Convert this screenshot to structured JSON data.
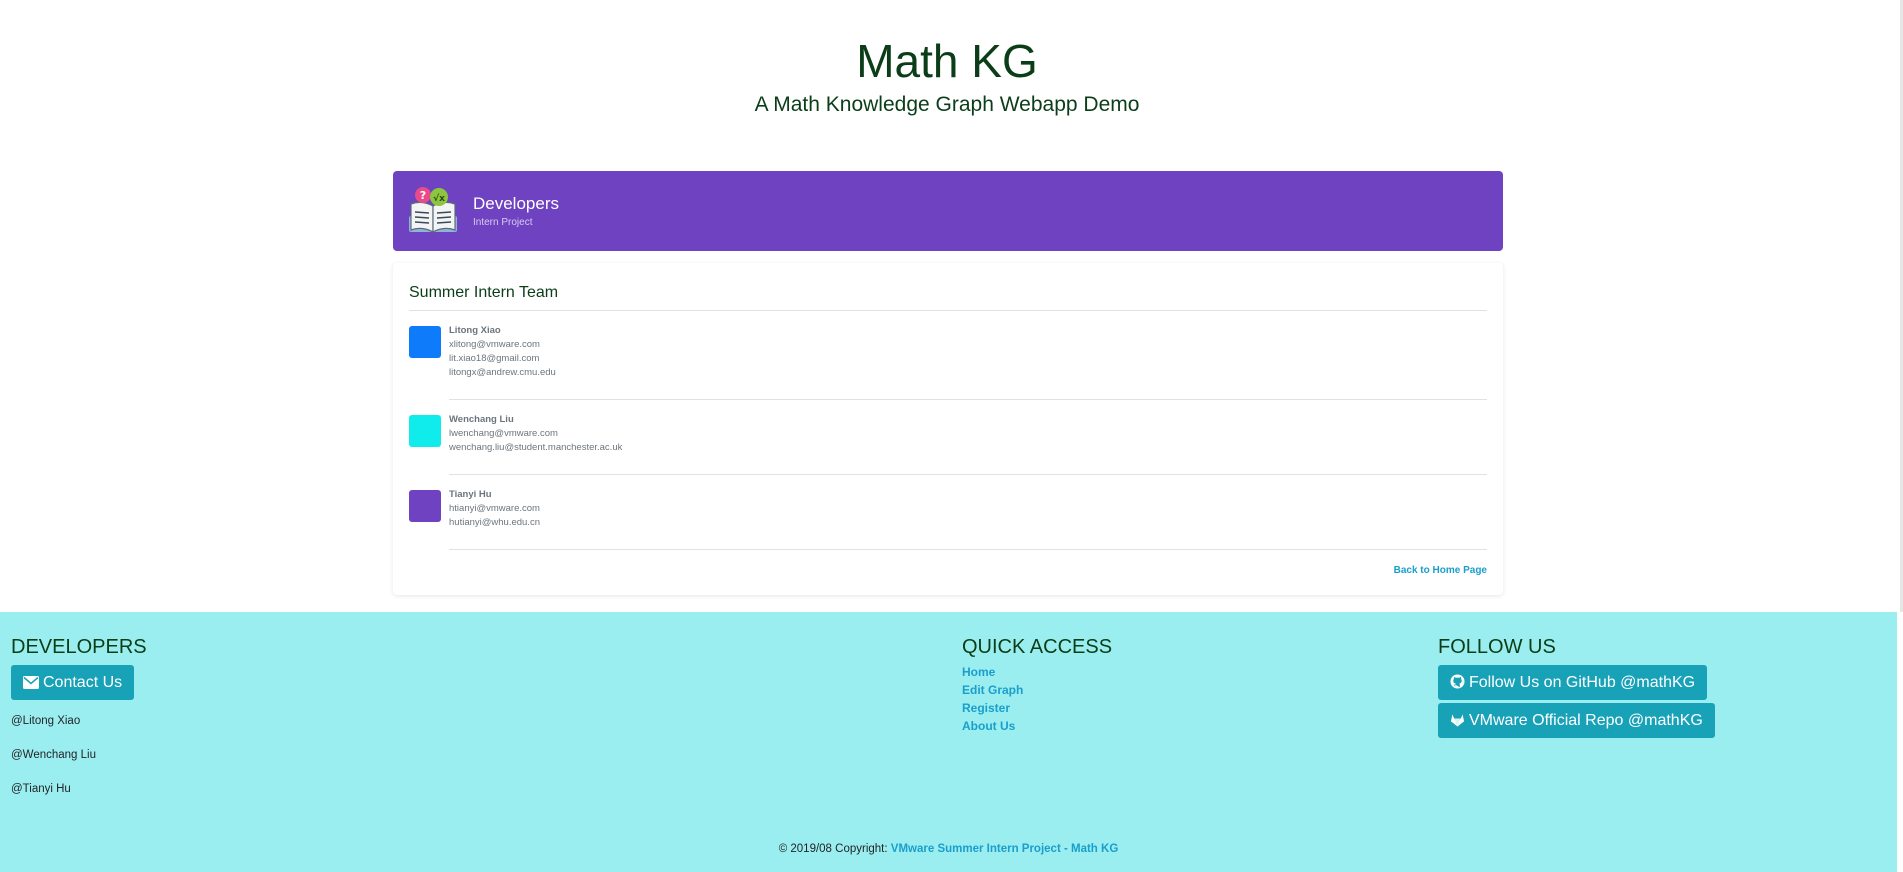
{
  "header": {
    "title": "Math KG",
    "subtitle": "A Math Knowledge Graph Webapp Demo"
  },
  "banner": {
    "title": "Developers",
    "subtitle": "Intern Project"
  },
  "team": {
    "heading": "Summer Intern Team",
    "members": [
      {
        "name": "Litong Xiao",
        "color": "#0d7bfa",
        "emails": [
          "xlitong@vmware.com",
          "lit.xiao18@gmail.com",
          "litongx@andrew.cmu.edu"
        ]
      },
      {
        "name": "Wenchang Liu",
        "color": "#10ebeb",
        "emails": [
          "lwenchang@vmware.com",
          "wenchang.liu@student.manchester.ac.uk"
        ]
      },
      {
        "name": "Tianyi Hu",
        "color": "#6f42c1",
        "emails": [
          "htianyi@vmware.com",
          "hutianyi@whu.edu.cn"
        ]
      }
    ],
    "back_link": "Back to Home Page"
  },
  "footer": {
    "developers": {
      "heading": "DEVELOPERS",
      "contact_label": "Contact Us",
      "names": [
        "@Litong Xiao",
        "@Wenchang Liu",
        "@Tianyi Hu"
      ]
    },
    "quick_access": {
      "heading": "QUICK ACCESS",
      "links": [
        "Home",
        "Edit Graph",
        "Register",
        "About Us"
      ]
    },
    "follow": {
      "heading": "FOLLOW US",
      "github_label": "Follow Us on GitHub @mathKG",
      "gitlab_label": "VMware Official Repo @mathKG"
    },
    "copyright_text": "© 2019/08 Copyright:",
    "copyright_link": "VMware Summer Intern Project - Math KG"
  },
  "colors": {
    "banner": "#6f42c1",
    "footer": "#9beef0",
    "button": "#17a2b8",
    "link": "#1a9ecb"
  }
}
